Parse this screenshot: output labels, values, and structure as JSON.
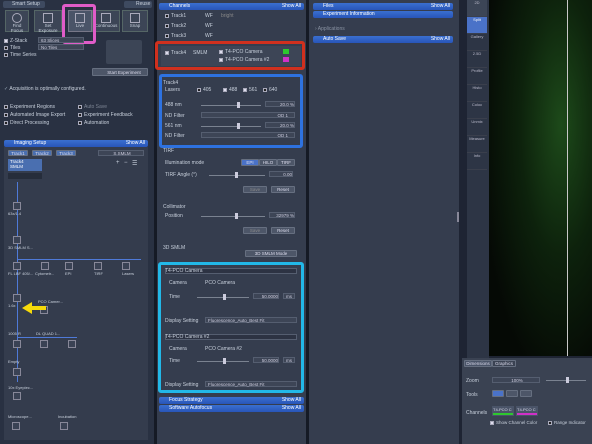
{
  "left": {
    "smart_setup": "Smart Setup",
    "reuse": "Reuse",
    "locate_tabs": [
      "Find Focus",
      "Set Exposure",
      "Live",
      "Continuous",
      "Snap"
    ],
    "zstack_label": "Z-Stack",
    "zstack_value": "63 Slices",
    "tiles_label": "Tiles",
    "tiles_value": "No Tiles",
    "timeseries_label": "Time Series",
    "start_experiment": "Start Experiment",
    "acq_msg": "Acquisition is optimally configured.",
    "opts": [
      "Experiment Regions",
      "Automated Image Export",
      "Direct Processing"
    ],
    "opts2": [
      "Auto Save",
      "Experiment Feedback",
      "Automation"
    ],
    "imaging_setup": "Imaging Setup",
    "show_all": "Show All",
    "tracks": [
      "Track1",
      "Track2",
      "Track3"
    ],
    "mode": "S.SMLM",
    "track4": "Track4",
    "smlm": "SMLM",
    "lp_labels": [
      "63x/1.4",
      "3D SMLM S...",
      "FL LBF 405/...",
      "Cytometr...",
      "EPI",
      "TIRF",
      "Lasers",
      "1.6x",
      "PCO Camer...",
      "1005 R",
      "DL QUAD 1...",
      "Empty",
      "10x Eyepiec...",
      "Microscope...",
      "Incubation"
    ]
  },
  "mid": {
    "channels_header": "Channels",
    "show_all": "Show All",
    "ch_top": [
      "Track1",
      "WF",
      "Track2",
      "WF",
      "Track3",
      "WF"
    ],
    "bright": "bright",
    "track4": "Track4",
    "smlm": "SMLM",
    "cam1": "T4-PCO Camera",
    "cam2": "T4-PCO Camera #2",
    "lasers_track": "Track4",
    "lasers_label": "Lasers",
    "laser_lines": [
      "405",
      "488",
      "561",
      "640"
    ],
    "l488": "488 nm",
    "p488": "20.0 %",
    "nd1": "ND Filter",
    "od1": "OD 1",
    "l561": "561 nm",
    "p561": "20.0 %",
    "nd2": "ND Filter",
    "od2": "OD 1",
    "tirf_header": "TIRF",
    "illum_mode": "Illumination mode",
    "illum_opts": [
      "EPI",
      "HILO",
      "TIRF"
    ],
    "tirf_angle": "TIRF Angle (°)",
    "tirf_angle_val": "0.00",
    "save": "Save",
    "reset": "Reset",
    "collimator": "Collimator",
    "position": "Position",
    "position_val": "32979 %",
    "smlm3d": "3D SMLM",
    "smlm3d_mode": "3D SMLM Mode",
    "camera_header": "T4-PCO Camera",
    "camera_label": "Camera",
    "camera_val": "PCO Camera",
    "time_label": "Time",
    "time_val": "50.0000",
    "time_unit": "ms",
    "display_label": "Display Setting",
    "display_val": "Fluorescence_Auto_Best Fit",
    "camera2_header": "T4-PCO Camera #2",
    "camera2_val": "PCO Camera #2",
    "focus_strategy": "Focus Strategy",
    "software_autofocus": "Software Autofocus"
  },
  "right": {
    "files": "Files",
    "experiment_information": "Experiment Information",
    "applications": "Applications",
    "auto_save": "Auto Save",
    "show_all": "Show All"
  },
  "side": [
    "2D",
    "Split",
    "Gallery",
    "2.5D",
    "Profile",
    "Histo",
    "Coloc",
    "Unmix",
    "Measure",
    "Info"
  ],
  "bottom": {
    "tabs": [
      "Dimensions",
      "Graphics"
    ],
    "zoom": "Zoom",
    "zoom_val": "100%",
    "tools": "Tools",
    "channels": "Channels",
    "ch1": "T4-PCO C",
    "ch2": "T4-PCO C",
    "show_color": "Show Channel Color",
    "range_indicator": "Range Indicator"
  }
}
